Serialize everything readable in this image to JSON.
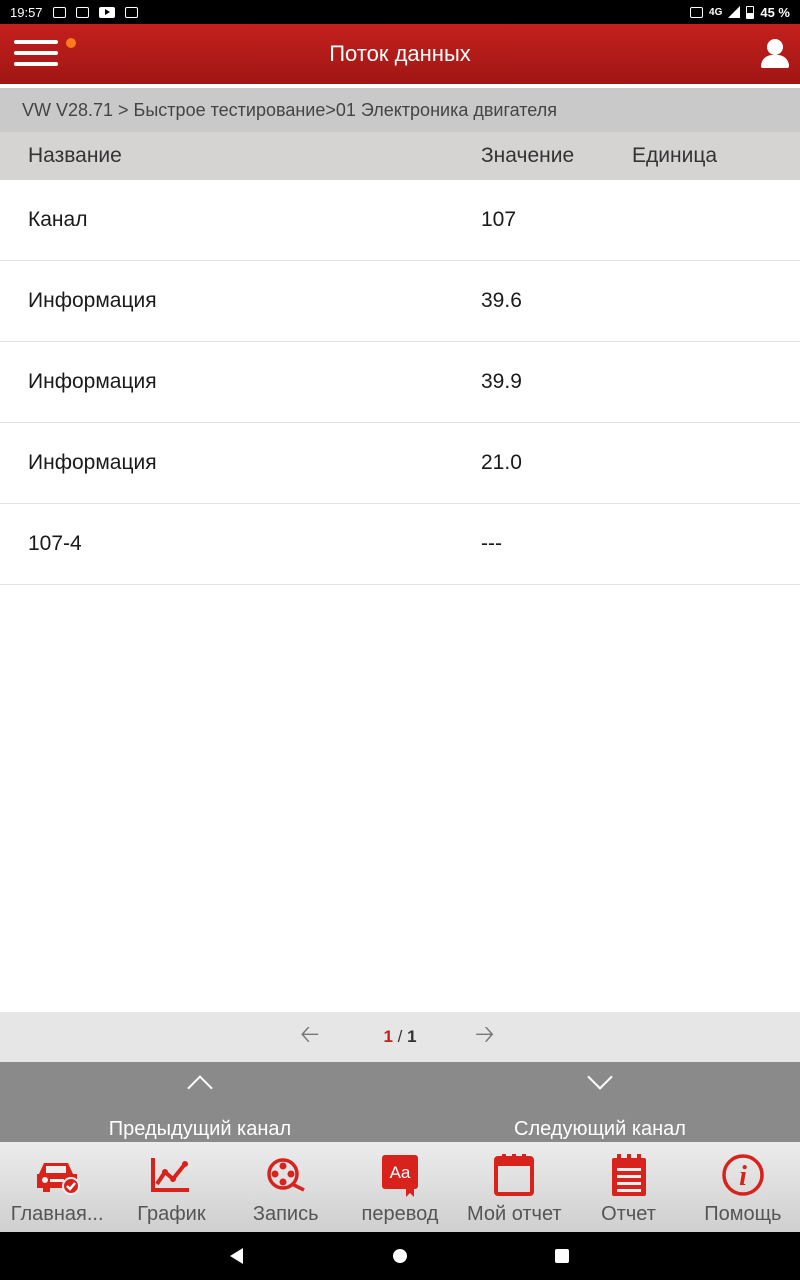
{
  "status_bar": {
    "time": "19:57",
    "network": "4G",
    "battery": "45 %"
  },
  "app_bar": {
    "title": "Поток данных"
  },
  "breadcrumb": "VW V28.71 > Быстрое тестирование>01 Электроника двигателя",
  "table": {
    "headers": {
      "name": "Название",
      "value": "Значение",
      "unit": "Единица"
    },
    "rows": [
      {
        "name": "Канал",
        "value": "107",
        "unit": ""
      },
      {
        "name": "Информация",
        "value": "39.6",
        "unit": ""
      },
      {
        "name": "Информация",
        "value": "39.9",
        "unit": ""
      },
      {
        "name": "Информация",
        "value": "21.0",
        "unit": ""
      },
      {
        "name": "107-4",
        "value": "---",
        "unit": ""
      }
    ]
  },
  "pager": {
    "current": "1",
    "separator": " / ",
    "total": "1"
  },
  "channel_nav": {
    "prev_label": "Предыдущий канал",
    "next_label": "Следующий канал"
  },
  "bottom_nav": [
    {
      "label": "Главная...",
      "icon": "car-check-icon"
    },
    {
      "label": "График",
      "icon": "graph-icon"
    },
    {
      "label": "Запись",
      "icon": "film-reel-icon"
    },
    {
      "label": "перевод",
      "icon": "translate-book-icon"
    },
    {
      "label": "Мой отчет",
      "icon": "calendar-report-icon"
    },
    {
      "label": "Отчет",
      "icon": "notepad-icon"
    },
    {
      "label": "Помощь",
      "icon": "info-icon"
    }
  ],
  "colors": {
    "accent": "#c4201d",
    "icon_red": "#d8221c",
    "breadcrumb_bg": "#c9c9c9",
    "header_bg": "#d6d3d3",
    "channel_bar": "#8a8a8a"
  }
}
